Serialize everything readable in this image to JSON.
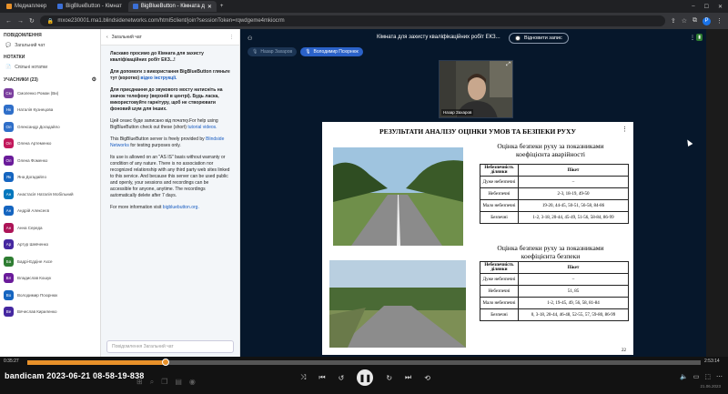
{
  "browser": {
    "tabs": [
      {
        "label": "Медиаплеер",
        "color": "#e8912a",
        "active": false
      },
      {
        "label": "BigBlueButton - Кімнат",
        "color": "#3b6fd6",
        "active": false
      },
      {
        "label": "BigBlueButton - Кімната д",
        "color": "#3b6fd6",
        "active": true
      }
    ],
    "url": "mxoe230001.rna1.blindsidenetworks.com/html5client/join?sessionToken=rqwdgeme4mkiocrm",
    "profile_initial": "P"
  },
  "userpanel": {
    "messages_title": "ПОВІДОМЛЕННЯ",
    "public_chat": "Загальний чат",
    "notes_title": "НОТАТКИ",
    "shared_notes": "Спільні нотатки",
    "participants_title": "УЧАСНИКИ (23)",
    "users": [
      {
        "initials": "См",
        "name": "Смоленко Роман (Ви)",
        "color": "#7b3f9e"
      },
      {
        "initials": "Нк",
        "name": "Наталія Кузнецова",
        "color": "#2f6fc9"
      },
      {
        "initials": "Ол",
        "name": "Олександр Догадайло",
        "color": "#2f6fc9"
      },
      {
        "initials": "Ол",
        "name": "Олена Артеменко",
        "color": "#c2185b"
      },
      {
        "initials": "Ол",
        "name": "Олена Фоменко",
        "color": "#6a1b9a"
      },
      {
        "initials": "Як",
        "name": "Яна Догадайло",
        "color": "#1565c0"
      },
      {
        "initials": "Ан",
        "name": "Анастасія Наталія Мобільний",
        "color": "#0277bd"
      },
      {
        "initials": "Ан",
        "name": "Андрій Алексеєв",
        "color": "#1565c0"
      },
      {
        "initials": "Ан",
        "name": "Анна Середа",
        "color": "#ad1457"
      },
      {
        "initials": "Ар",
        "name": "Артур Шевченко",
        "color": "#4527a0"
      },
      {
        "initials": "Ба",
        "name": "Бадрі-Еддіне Ахсе",
        "color": "#2e7d32"
      },
      {
        "initials": "Вл",
        "name": "Владислав Кошук",
        "color": "#6a1b9a"
      },
      {
        "initials": "Во",
        "name": "Володимир Псюрнюк",
        "color": "#1565c0"
      },
      {
        "initials": "Ве",
        "name": "Вячеслав Кириленко",
        "color": "#4527a0"
      }
    ]
  },
  "chat": {
    "title": "Загальний чат",
    "welcome": "Ласкаво просимо до Кімната для захисту кваліфікаційних робіт ЕКЗ...!",
    "help_pre": "Для допомоги з використання BigBlueButton гляньте тут (коротко) ",
    "help_link": "відео інструкції.",
    "audio": "Для приєднання до звукового мосту натисніть на значок телефону (верхній в центрі). Будь ласка, використовуйте гарнітуру, щоб не створювати фоновий шум для інших.",
    "recorded_pre": "Цей сеанс буде записано від початку.For help using BigBlueButton check out these (short) ",
    "recorded_link": "tutorial videos.",
    "provided_pre": "This BigBlueButton server is freely provided by ",
    "provided_link": "Blindside Networks",
    "provided_post": " for testing purposes only.",
    "terms": "Its use is allowed on an \"AS IS\" basis without warranty or condition of any nature. There is no association nor recognized relationship with any third party web sites linked to this service. And because this server can be used public and openly, your sessions and recordings can be accessible for anyone, anytime. The recordings automatically delete after 7 days.",
    "more_pre": "For more information visit ",
    "more_link": "bigbluebutton.org.",
    "input_placeholder": "Повідомлення Загальний чат"
  },
  "meeting": {
    "title": "Кімната для захисту кваліфікаційних робіт ЕКЗ...",
    "record_label": "Відновити запис",
    "talkers": [
      "Назар Захаров",
      "Володимир Псюрнюк"
    ],
    "webcam_name": "Назар Захаров"
  },
  "slide": {
    "title": "РЕЗУЛЬТАТИ АНАЛІЗУ ОЦІНКИ УМОВ ТА БЕЗПЕКИ РУХУ",
    "table1_heading": "Оцінка безпеки руху за показниками коефіцієнта аварійності",
    "table2_heading": "Оцінка безпеки руху за показниками коефіцієнта безпеки",
    "col1": "Небезпечність ділянки",
    "col2": "Пікет",
    "table1_rows": [
      [
        "Дуже небезпечні",
        "–"
      ],
      [
        "Небезпечні",
        "2-3, 18-19, 49-50"
      ],
      [
        "Мало небезпечні",
        "19-20, 44-45, 50-51, 56-58, 84-86"
      ],
      [
        "Безпечні",
        "1-2, 3-18, 20-44, 45-49, 51-56, 58-84, 86-99"
      ]
    ],
    "table2_rows": [
      [
        "Дуже небезпечні",
        "–"
      ],
      [
        "Небезпечні",
        "51, 85"
      ],
      [
        "Мало небезпечні",
        "1-2, 19-45, 49, 56, 58, 81-84"
      ],
      [
        "Безпечні",
        "0, 3-18, 20-44, 46-48, 52-55, 57, 59-80, 86-99"
      ]
    ],
    "page_number": "22"
  },
  "player": {
    "elapsed": "0:35:27",
    "total": "2:53:14",
    "progress_fraction": 0.205,
    "watermark": "bandicam 2023-06-21 08-58-19-838",
    "tray_date": "21.06.2023"
  }
}
